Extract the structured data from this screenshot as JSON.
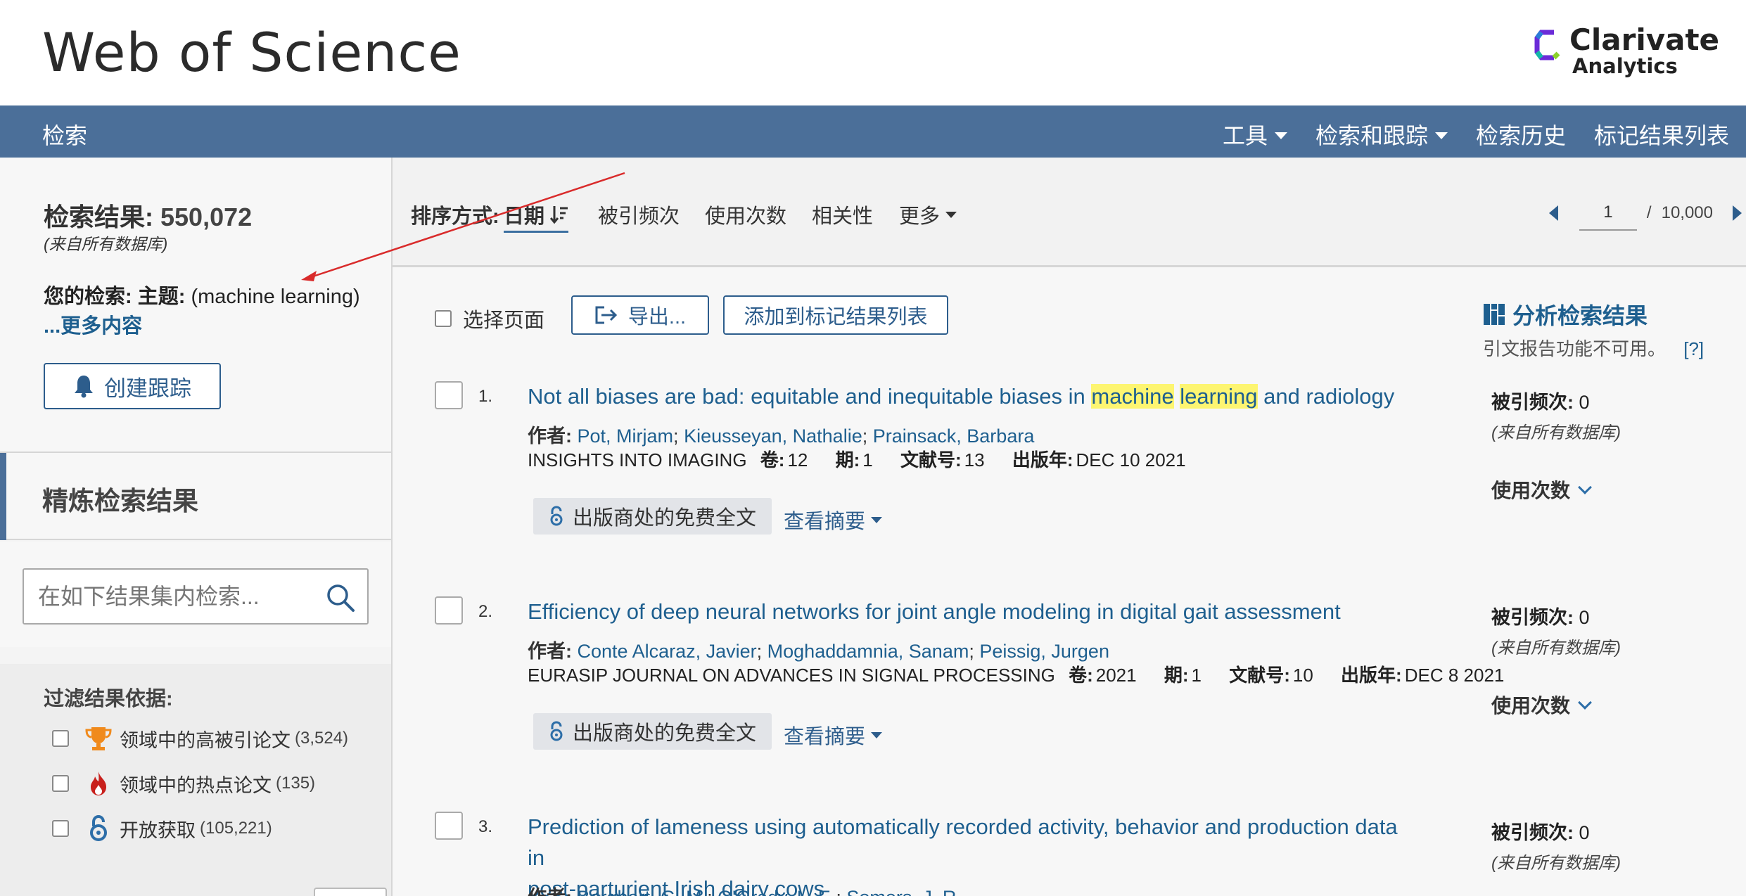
{
  "header": {
    "site_title": "Web of Science",
    "brand_name": "Clarivate",
    "brand_sub": "Analytics"
  },
  "nav": {
    "left": "检索",
    "items": [
      {
        "label": "工具",
        "dropdown": true
      },
      {
        "label": "检索和跟踪",
        "dropdown": true
      },
      {
        "label": "检索历史",
        "dropdown": false
      },
      {
        "label": "标记结果列表",
        "dropdown": false
      }
    ]
  },
  "sidebar": {
    "result_label": "检索结果",
    "result_count": "550,072",
    "result_source": "(来自所有数据库)",
    "your_search_label": "您的检索:",
    "topic_label": "主题:",
    "query": "(machine learning)",
    "more_link": "...更多内容",
    "create_alert": "创建跟踪",
    "refine_title": "精炼检索结果",
    "search_within_placeholder": "在如下结果集内检索...",
    "filter_title": "过滤结果依据:",
    "filters": [
      {
        "label": "领域中的高被引论文",
        "count": "(3,524)",
        "icon": "trophy-icon"
      },
      {
        "label": "领域中的热点论文",
        "count": "(135)",
        "icon": "flame-icon"
      },
      {
        "label": "开放获取",
        "count": "(105,221)",
        "icon": "open-access-icon"
      }
    ]
  },
  "sort": {
    "label": "排序方式:",
    "active": "日期",
    "options": [
      "被引频次",
      "使用次数",
      "相关性"
    ],
    "more": "更多"
  },
  "pager": {
    "current": "1",
    "separator": "/",
    "total": "10,000"
  },
  "actions": {
    "select_page": "选择页面",
    "export": "导出...",
    "add_to_marked": "添加到标记结果列表",
    "analyze": "分析检索结果",
    "cite_note": "引文报告功能不可用。",
    "cite_help": "[?]"
  },
  "records": [
    {
      "num": "1.",
      "title_pre": "Not all biases are bad: equitable and inequitable biases in ",
      "title_hl1": "machine",
      "title_mid": " ",
      "title_hl2": "learning",
      "title_post": " and radiology",
      "title_line2": "",
      "authors_label": "作者:",
      "authors": [
        "Pot, Mirjam",
        "Kieusseyan, Nathalie",
        "Prainsack, Barbara"
      ],
      "journal": "INSIGHTS INTO IMAGING",
      "vol_label": "卷:",
      "vol": "12",
      "issue_label": "期:",
      "issue": "1",
      "doc_label": "文献号:",
      "doc": "13",
      "year_label": "出版年:",
      "year": "DEC 10 2021",
      "oa_button": "出版商处的免费全文",
      "abstract_link": "查看摘要",
      "cited_label": "被引频次:",
      "cited": "0",
      "cited_source": "(来自所有数据库)",
      "usage_label": "使用次数"
    },
    {
      "num": "2.",
      "title_pre": "Efficiency of deep neural networks for joint angle modeling in digital gait assessment",
      "title_hl1": "",
      "title_mid": "",
      "title_hl2": "",
      "title_post": "",
      "title_line2": "",
      "authors_label": "作者:",
      "authors": [
        "Conte Alcaraz, Javier",
        "Moghaddamnia, Sanam",
        "Peissig, Jurgen"
      ],
      "journal": "EURASIP JOURNAL ON ADVANCES IN SIGNAL PROCESSING",
      "vol_label": "卷:",
      "vol": "2021",
      "issue_label": "期:",
      "issue": "1",
      "doc_label": "文献号:",
      "doc": "10",
      "year_label": "出版年:",
      "year": "DEC 8 2021",
      "oa_button": "出版商处的免费全文",
      "abstract_link": "查看摘要",
      "cited_label": "被引频次:",
      "cited": "0",
      "cited_source": "(来自所有数据库)",
      "usage_label": "使用次数"
    },
    {
      "num": "3.",
      "title_pre": "Prediction of lameness using automatically recorded activity, behavior and production data in",
      "title_hl1": "",
      "title_mid": "",
      "title_hl2": "",
      "title_post": "",
      "title_line2": "post-parturient Irish dairy cows",
      "authors_label": "作者:",
      "authors": [
        "Borghart, G. M.",
        "O'Grady, L. E.",
        "Somers, J. R."
      ],
      "cited_label": "被引频次:",
      "cited": "0",
      "cited_source": "(来自所有数据库)"
    }
  ],
  "colors": {
    "nav_bg": "#4b6f99",
    "link": "#1e5f8f",
    "highlight": "#fdf571",
    "annotation_arrow": "#d92b2b"
  }
}
